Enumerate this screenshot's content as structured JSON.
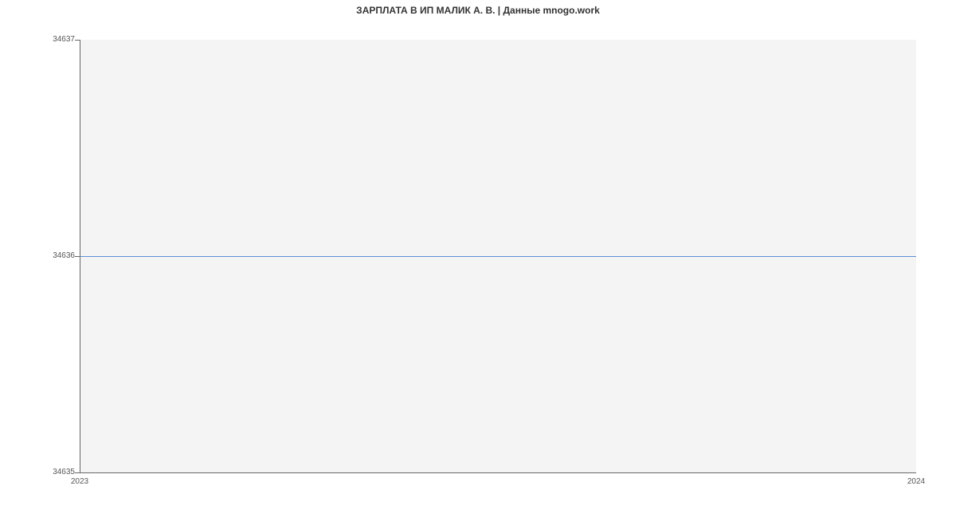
{
  "chart_data": {
    "type": "line",
    "title": "ЗАРПЛАТА В ИП МАЛИК А. В. | Данные mnogo.work",
    "x": [
      2023,
      2024
    ],
    "values": [
      34636,
      34636
    ],
    "x_ticks": [
      "2023",
      "2024"
    ],
    "y_ticks": [
      "34635",
      "34636",
      "34637"
    ],
    "xlim": [
      2023,
      2024
    ],
    "ylim": [
      34635,
      34637
    ],
    "series_color": "#5b8fd6"
  }
}
